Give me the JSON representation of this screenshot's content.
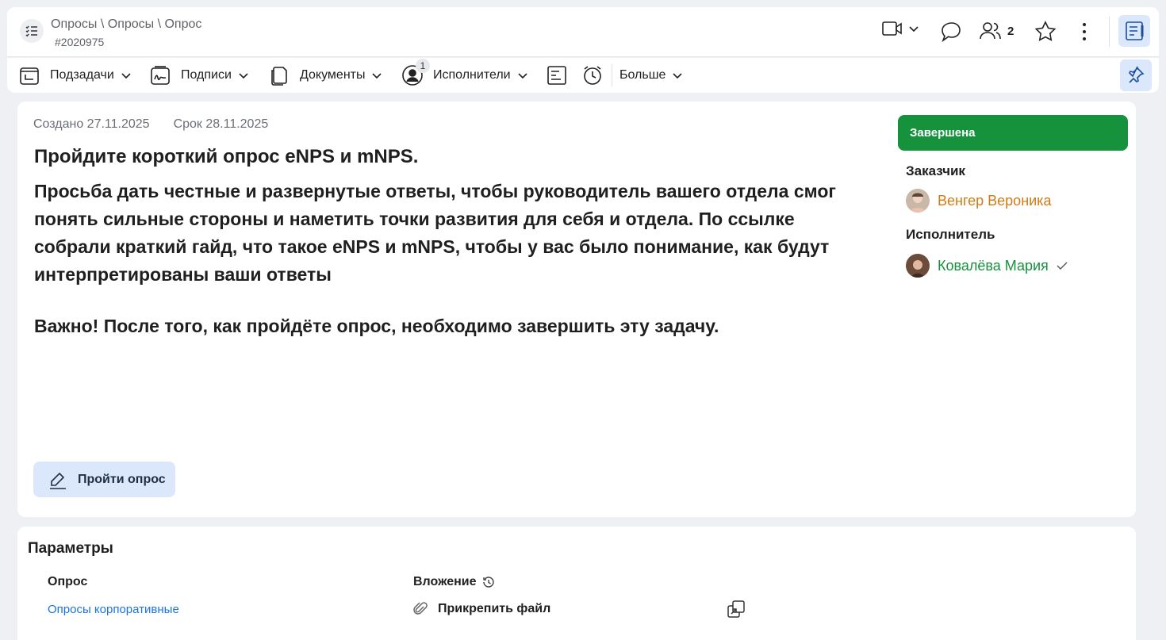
{
  "header": {
    "breadcrumb": "Опросы \\ Опросы \\ Опрос",
    "task_number": "#2020975",
    "participants_count": "2"
  },
  "toolbar": {
    "subtasks": "Подзадачи",
    "signatures": "Подписи",
    "documents": "Документы",
    "executors": "Исполнители",
    "executors_badge": "1",
    "more": "Больше"
  },
  "task": {
    "created": "Создано 27.11.2025",
    "deadline": "Срок 28.11.2025",
    "title": "Пройдите короткий опрос eNPS и mNPS.",
    "description": "Просьба дать честные и развернутые ответы, чтобы руководитель вашего отдела смог\nпонять сильные стороны и наметить точки развития для себя и отдела. По ссылке\nсобрали краткий гайд, что такое eNPS и mNPS, чтобы у вас было понимание, как будут\nинтерпретированы ваши ответы",
    "important": "Важно! После того, как пройдёте опрос, необходимо завершить эту задачу.",
    "survey_button": "Пройти опрос"
  },
  "side": {
    "status": "Завершена",
    "status_color": "#16913c",
    "customer_label": "Заказчик",
    "customer_name": "Венгер Вероника",
    "executor_label": "Исполнитель",
    "executor_name": "Ковалёва Мария"
  },
  "params": {
    "title": "Параметры",
    "survey_label": "Опрос",
    "survey_value": "Опросы корпоративные",
    "attachment_label": "Вложение",
    "attach_file": "Прикрепить файл"
  },
  "colors": {
    "accent_bg": "#dbe8fb",
    "link": "#1a73e8",
    "customer": "#d27a13"
  }
}
